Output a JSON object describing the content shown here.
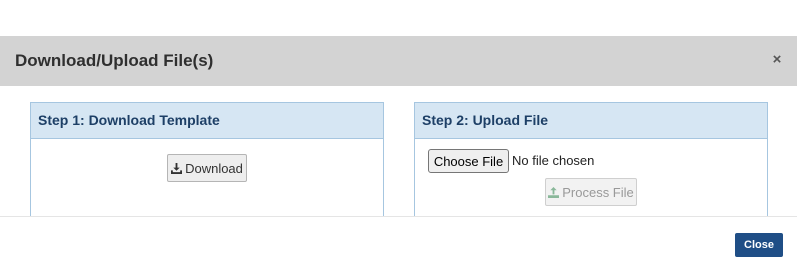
{
  "modal": {
    "title": "Download/Upload File(s)",
    "close_glyph": "×"
  },
  "step1": {
    "heading": "Step 1: Download Template",
    "download_label": "Download",
    "download_icon": "download-icon"
  },
  "step2": {
    "heading": "Step 2: Upload File",
    "choose_file_label": "Choose File",
    "file_status": "No file chosen",
    "process_label": "Process File",
    "process_icon": "upload-icon"
  },
  "footer": {
    "close_label": "Close"
  },
  "colors": {
    "header_bg": "#d3d3d3",
    "panel_heading_bg": "#d6e6f3",
    "panel_border": "#a6c6e0",
    "primary_button": "#1f4e86",
    "disabled_icon": "#8ab89a"
  }
}
